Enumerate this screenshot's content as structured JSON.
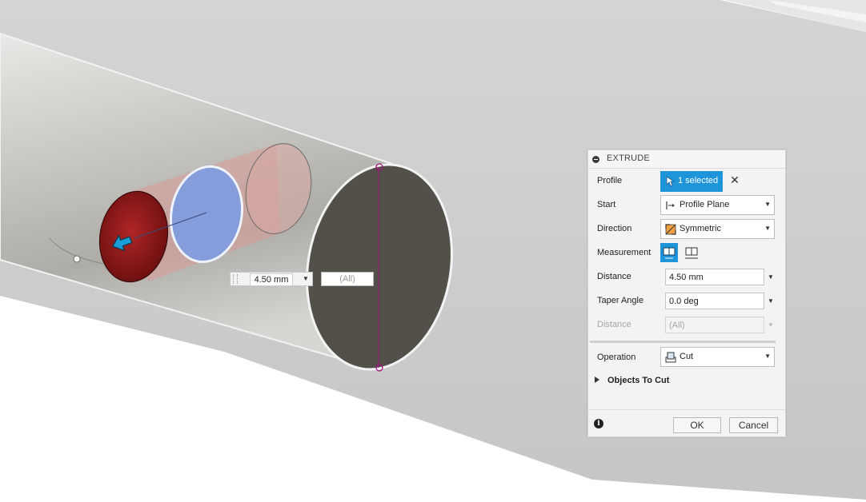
{
  "dialog": {
    "title": "EXTRUDE",
    "profile": {
      "label": "Profile",
      "value": "1 selected"
    },
    "start": {
      "label": "Start",
      "value": "Profile Plane"
    },
    "direction": {
      "label": "Direction",
      "value": "Symmetric"
    },
    "measurement": {
      "label": "Measurement"
    },
    "distance": {
      "label": "Distance",
      "value": "4.50 mm"
    },
    "taper_angle": {
      "label": "Taper Angle",
      "value": "0.0 deg"
    },
    "distance2": {
      "label": "Distance",
      "value": "(All)"
    },
    "operation": {
      "label": "Operation",
      "value": "Cut"
    },
    "objects_to_cut": {
      "label": "Objects To Cut"
    },
    "ok_label": "OK",
    "cancel_label": "Cancel"
  },
  "canvas": {
    "distance_manipulator_value": "4.50 mm",
    "distance2_manipulator_value": "(All)"
  },
  "colors": {
    "accent": "#1f95d9",
    "cut_profile": "#8b1a1a",
    "selected_face": "#7f9cdf",
    "end_face": "#525049",
    "axis_line": "#a3137f"
  }
}
